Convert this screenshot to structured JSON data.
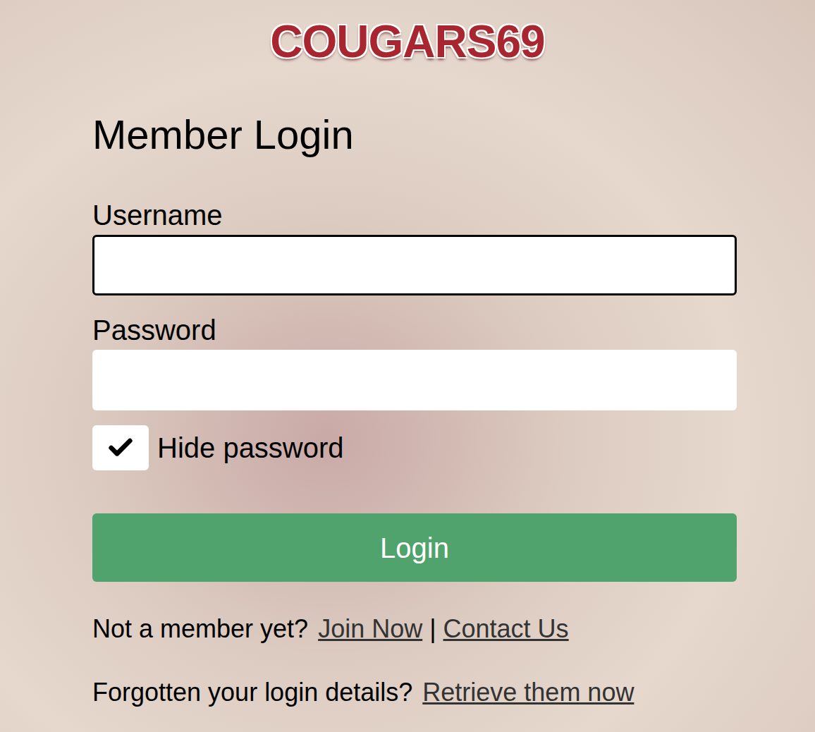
{
  "logo": {
    "text": "COUGARS69"
  },
  "heading": "Member Login",
  "fields": [
    {
      "label": "Username",
      "value": "",
      "focused": true,
      "kind": "text"
    },
    {
      "label": "Password",
      "value": "",
      "focused": false,
      "kind": "password"
    }
  ],
  "hide_password": {
    "label": "Hide password",
    "checked": true
  },
  "login_button": {
    "label": "Login"
  },
  "footer": [
    {
      "text": "Not a member yet?",
      "links": [
        "Join Now",
        "Contact Us"
      ],
      "separator": "|"
    },
    {
      "text": "Forgotten your login details?",
      "links": [
        "Retrieve them now"
      ],
      "separator": ""
    }
  ]
}
